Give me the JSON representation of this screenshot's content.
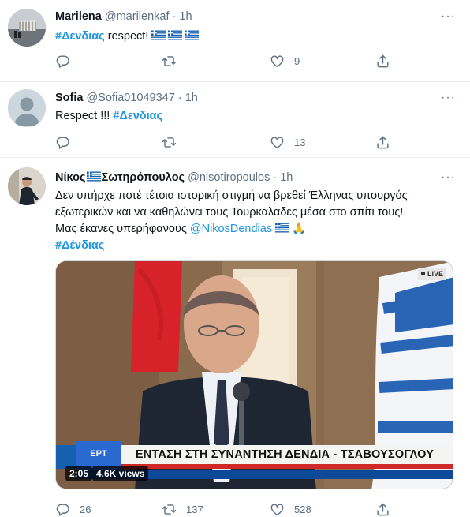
{
  "tweets": [
    {
      "name": "Marilena",
      "handle": "@marilenkaf",
      "sep": "·",
      "time": "1h",
      "text_hashtag": "#Δενδιας",
      "text_rest": " respect! ",
      "flags": [
        "greek-flag",
        "greek-flag",
        "greek-flag"
      ],
      "replies": "",
      "retweets": "",
      "likes": "9"
    },
    {
      "name": "Sofia",
      "handle": "@Sofia01049347",
      "sep": "·",
      "time": "1h",
      "text_pre": "Respect !!! ",
      "text_hashtag": "#Δενδιας",
      "replies": "",
      "retweets": "",
      "likes": "13"
    },
    {
      "name_part1": "Νίκος",
      "name_part2": "Σωτηρόπουλος",
      "handle": "@nisotiropoulos",
      "sep": "·",
      "time": "1h",
      "line1": "Δεν υπήρχε ποτέ τέτοια ιστορική στιγμή να βρεθεί Έλληνας υπουργός",
      "line2": "εξωτερικών και να καθηλώνει τους Τουρκαλαδες μέσα στο σπίτι τους!",
      "line3_pre": "Μας έκανες υπερήφανους ",
      "mention": "@NikosDendias",
      "emoji": "🙏",
      "hashtag": "#Δένδιας",
      "video": {
        "live_label": "LIVE",
        "banner": "ΕΝΤΑΣΗ ΣΤΗ ΣΥΝΑΝΤΗΣΗ ΔΕΝΔΙΑ - ΤΣΑΒΟΥΣΟΓΛΟΥ",
        "channel_logo": "ΕΡΤ",
        "duration": "2:05",
        "views": "4.6K views"
      },
      "replies": "26",
      "retweets": "137",
      "likes": "528"
    }
  ],
  "icons": {
    "more": "more-icon",
    "reply": "reply-icon",
    "retweet": "retweet-icon",
    "like": "like-icon",
    "share": "share-icon"
  },
  "colors": {
    "link": "#1b95e0",
    "muted": "#5b7083",
    "divider": "#e6ecf0"
  }
}
